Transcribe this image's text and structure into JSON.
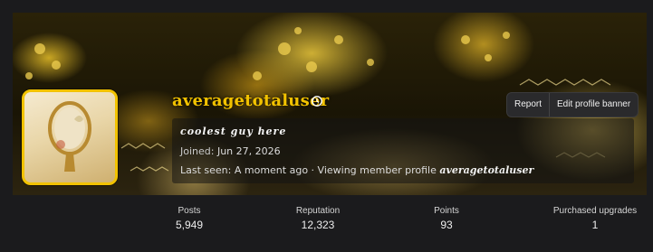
{
  "profile": {
    "username": "averagetotaluser",
    "tagline": "coolest guy here",
    "joined_label": "Joined:",
    "joined_date": "Jun 27, 2026",
    "last_seen_label": "Last seen:",
    "last_seen_text": "A moment ago · Viewing member profile",
    "last_seen_user": "averagetotaluser"
  },
  "actions": {
    "report_label": "Report",
    "edit_banner_label": "Edit profile banner"
  },
  "stats": [
    {
      "label": "Posts",
      "value": "5,949"
    },
    {
      "label": "Reputation",
      "value": "12,323"
    },
    {
      "label": "Points",
      "value": "93"
    },
    {
      "label": "Purchased upgrades",
      "value": "1"
    }
  ],
  "icons": {
    "username_history": "history-icon"
  },
  "colors": {
    "username": "#f2c200",
    "avatar_border": "#f2c200",
    "background": "#1b1b1d"
  }
}
